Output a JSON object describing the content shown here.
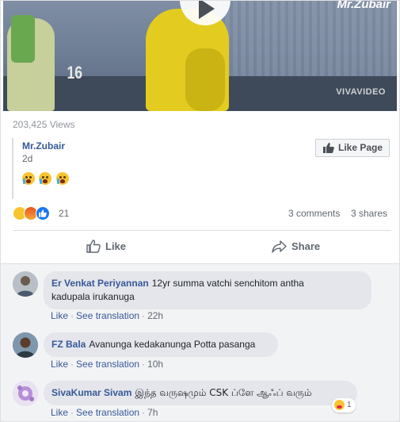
{
  "video": {
    "brand": "Mr.Zubair",
    "number_on_wall": "16",
    "watermark": "VIVAVIDEO"
  },
  "post": {
    "views": "203,425 Views",
    "author": "Mr.Zubair",
    "time": "2d",
    "emojis": [
      "crying-face",
      "crying-face",
      "crying-face"
    ],
    "like_page_label": "Like Page"
  },
  "reactions": {
    "icons": [
      "sad",
      "angry",
      "like"
    ],
    "count": "21",
    "comments": "3 comments",
    "shares": "3 shares"
  },
  "actions": {
    "like": "Like",
    "share": "Share"
  },
  "comments": [
    {
      "name": "Er Venkat Periyannan",
      "text_line1": "12yr summa vatchi senchitom antha",
      "text_line2": "kadupala irukanuga",
      "like": "Like",
      "translate": "See translation",
      "time": "22h"
    },
    {
      "name": "FZ Bala",
      "text": "Avanunga kedakanunga Potta pasanga",
      "like": "Like",
      "translate": "See translation",
      "time": "10h"
    },
    {
      "name": "SivaKumar Sivam",
      "text": "இந்த வருஷமும் CSK ப்ளே ஆஃப் வரும்",
      "like": "Like",
      "translate": "See translation",
      "time": "7h",
      "reaction_count": "1"
    }
  ],
  "colors": {
    "link": "#385898",
    "muted": "#616770",
    "bubble": "#e4e6eb",
    "comments_bg": "#f2f3f5",
    "fb_blue": "#1877f2"
  }
}
